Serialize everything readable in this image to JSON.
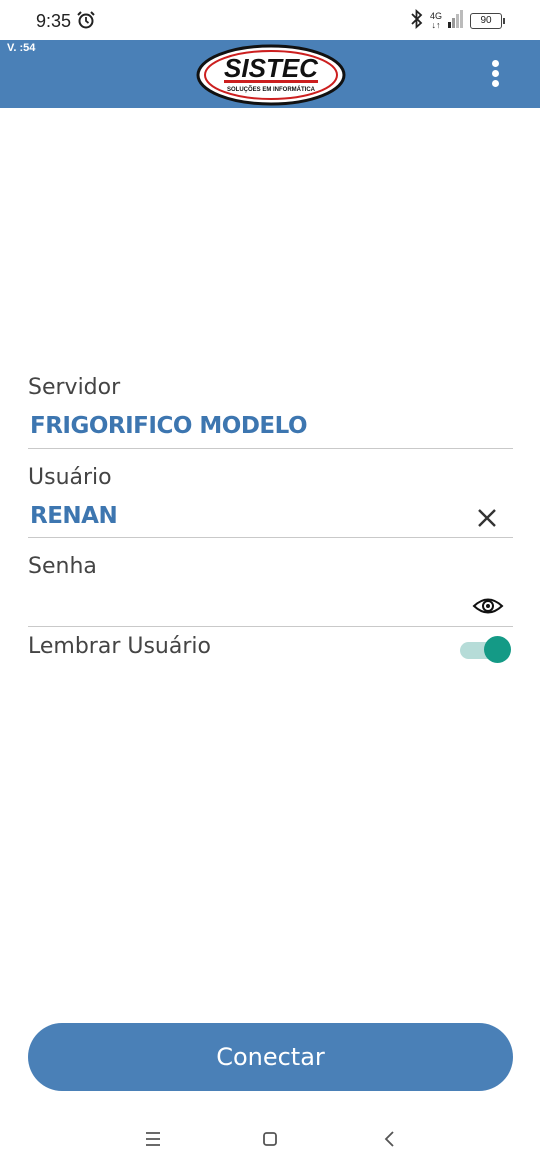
{
  "status_bar": {
    "time": "9:35",
    "network_top": "4G",
    "network_bottom": "↓↑",
    "battery": "90"
  },
  "app_bar": {
    "version": "V. :54",
    "logo_text": "SISTEC",
    "logo_tagline": "SOLUÇÕES EM INFORMÁTICA"
  },
  "form": {
    "server_label": "Servidor",
    "server_value": "FRIGORIFICO MODELO",
    "user_label": "Usuário",
    "user_value": "RENAN",
    "password_label": "Senha",
    "password_value": "",
    "remember_label": "Lembrar Usuário",
    "remember_on": true
  },
  "connect_label": "Conectar",
  "colors": {
    "primary": "#4a80b7",
    "value_text": "#3d76b0",
    "toggle_on": "#149a86"
  }
}
